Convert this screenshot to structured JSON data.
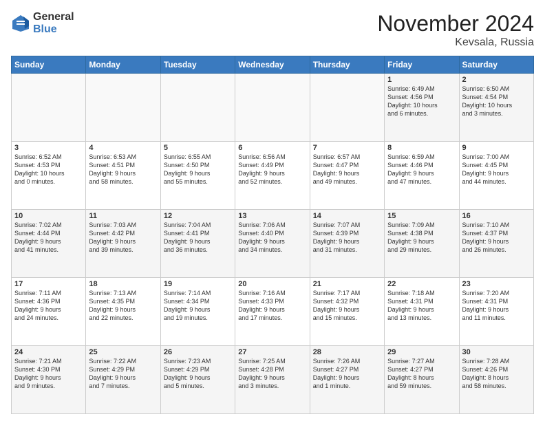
{
  "header": {
    "logo_general": "General",
    "logo_blue": "Blue",
    "title": "November 2024",
    "subtitle": "Kevsala, Russia"
  },
  "weekdays": [
    "Sunday",
    "Monday",
    "Tuesday",
    "Wednesday",
    "Thursday",
    "Friday",
    "Saturday"
  ],
  "rows": [
    [
      {
        "day": "",
        "info": ""
      },
      {
        "day": "",
        "info": ""
      },
      {
        "day": "",
        "info": ""
      },
      {
        "day": "",
        "info": ""
      },
      {
        "day": "",
        "info": ""
      },
      {
        "day": "1",
        "info": "Sunrise: 6:49 AM\nSunset: 4:56 PM\nDaylight: 10 hours\nand 6 minutes."
      },
      {
        "day": "2",
        "info": "Sunrise: 6:50 AM\nSunset: 4:54 PM\nDaylight: 10 hours\nand 3 minutes."
      }
    ],
    [
      {
        "day": "3",
        "info": "Sunrise: 6:52 AM\nSunset: 4:53 PM\nDaylight: 10 hours\nand 0 minutes."
      },
      {
        "day": "4",
        "info": "Sunrise: 6:53 AM\nSunset: 4:51 PM\nDaylight: 9 hours\nand 58 minutes."
      },
      {
        "day": "5",
        "info": "Sunrise: 6:55 AM\nSunset: 4:50 PM\nDaylight: 9 hours\nand 55 minutes."
      },
      {
        "day": "6",
        "info": "Sunrise: 6:56 AM\nSunset: 4:49 PM\nDaylight: 9 hours\nand 52 minutes."
      },
      {
        "day": "7",
        "info": "Sunrise: 6:57 AM\nSunset: 4:47 PM\nDaylight: 9 hours\nand 49 minutes."
      },
      {
        "day": "8",
        "info": "Sunrise: 6:59 AM\nSunset: 4:46 PM\nDaylight: 9 hours\nand 47 minutes."
      },
      {
        "day": "9",
        "info": "Sunrise: 7:00 AM\nSunset: 4:45 PM\nDaylight: 9 hours\nand 44 minutes."
      }
    ],
    [
      {
        "day": "10",
        "info": "Sunrise: 7:02 AM\nSunset: 4:44 PM\nDaylight: 9 hours\nand 41 minutes."
      },
      {
        "day": "11",
        "info": "Sunrise: 7:03 AM\nSunset: 4:42 PM\nDaylight: 9 hours\nand 39 minutes."
      },
      {
        "day": "12",
        "info": "Sunrise: 7:04 AM\nSunset: 4:41 PM\nDaylight: 9 hours\nand 36 minutes."
      },
      {
        "day": "13",
        "info": "Sunrise: 7:06 AM\nSunset: 4:40 PM\nDaylight: 9 hours\nand 34 minutes."
      },
      {
        "day": "14",
        "info": "Sunrise: 7:07 AM\nSunset: 4:39 PM\nDaylight: 9 hours\nand 31 minutes."
      },
      {
        "day": "15",
        "info": "Sunrise: 7:09 AM\nSunset: 4:38 PM\nDaylight: 9 hours\nand 29 minutes."
      },
      {
        "day": "16",
        "info": "Sunrise: 7:10 AM\nSunset: 4:37 PM\nDaylight: 9 hours\nand 26 minutes."
      }
    ],
    [
      {
        "day": "17",
        "info": "Sunrise: 7:11 AM\nSunset: 4:36 PM\nDaylight: 9 hours\nand 24 minutes."
      },
      {
        "day": "18",
        "info": "Sunrise: 7:13 AM\nSunset: 4:35 PM\nDaylight: 9 hours\nand 22 minutes."
      },
      {
        "day": "19",
        "info": "Sunrise: 7:14 AM\nSunset: 4:34 PM\nDaylight: 9 hours\nand 19 minutes."
      },
      {
        "day": "20",
        "info": "Sunrise: 7:16 AM\nSunset: 4:33 PM\nDaylight: 9 hours\nand 17 minutes."
      },
      {
        "day": "21",
        "info": "Sunrise: 7:17 AM\nSunset: 4:32 PM\nDaylight: 9 hours\nand 15 minutes."
      },
      {
        "day": "22",
        "info": "Sunrise: 7:18 AM\nSunset: 4:31 PM\nDaylight: 9 hours\nand 13 minutes."
      },
      {
        "day": "23",
        "info": "Sunrise: 7:20 AM\nSunset: 4:31 PM\nDaylight: 9 hours\nand 11 minutes."
      }
    ],
    [
      {
        "day": "24",
        "info": "Sunrise: 7:21 AM\nSunset: 4:30 PM\nDaylight: 9 hours\nand 9 minutes."
      },
      {
        "day": "25",
        "info": "Sunrise: 7:22 AM\nSunset: 4:29 PM\nDaylight: 9 hours\nand 7 minutes."
      },
      {
        "day": "26",
        "info": "Sunrise: 7:23 AM\nSunset: 4:29 PM\nDaylight: 9 hours\nand 5 minutes."
      },
      {
        "day": "27",
        "info": "Sunrise: 7:25 AM\nSunset: 4:28 PM\nDaylight: 9 hours\nand 3 minutes."
      },
      {
        "day": "28",
        "info": "Sunrise: 7:26 AM\nSunset: 4:27 PM\nDaylight: 9 hours\nand 1 minute."
      },
      {
        "day": "29",
        "info": "Sunrise: 7:27 AM\nSunset: 4:27 PM\nDaylight: 8 hours\nand 59 minutes."
      },
      {
        "day": "30",
        "info": "Sunrise: 7:28 AM\nSunset: 4:26 PM\nDaylight: 8 hours\nand 58 minutes."
      }
    ]
  ]
}
